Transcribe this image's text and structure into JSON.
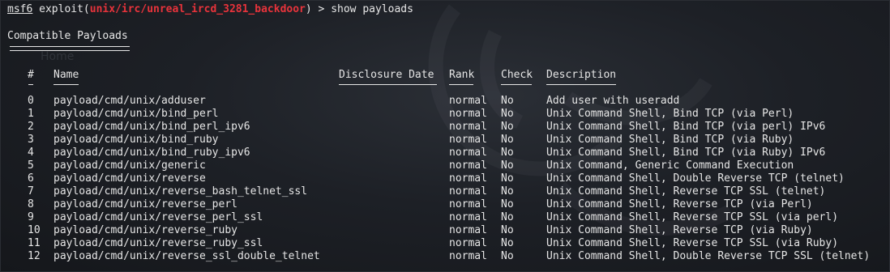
{
  "prompt": {
    "msf": "msf6",
    "exploit_prefix": " exploit(",
    "module": "unix/irc/unreal_ircd_3281_backdoor",
    "suffix": ") > ",
    "command": "show payloads"
  },
  "section_title": "Compatible Payloads",
  "background_ghost_text": "Home",
  "columns": {
    "num": "#",
    "name": "Name",
    "disclosure_date": "Disclosure Date",
    "rank": "Rank",
    "check": "Check",
    "description": "Description"
  },
  "rows": [
    {
      "num": "0",
      "name": "payload/cmd/unix/adduser",
      "rank": "normal",
      "check": "No",
      "description": "Add user with useradd"
    },
    {
      "num": "1",
      "name": "payload/cmd/unix/bind_perl",
      "rank": "normal",
      "check": "No",
      "description": "Unix Command Shell, Bind TCP (via Perl)"
    },
    {
      "num": "2",
      "name": "payload/cmd/unix/bind_perl_ipv6",
      "rank": "normal",
      "check": "No",
      "description": "Unix Command Shell, Bind TCP (via perl) IPv6"
    },
    {
      "num": "3",
      "name": "payload/cmd/unix/bind_ruby",
      "rank": "normal",
      "check": "No",
      "description": "Unix Command Shell, Bind TCP (via Ruby)"
    },
    {
      "num": "4",
      "name": "payload/cmd/unix/bind_ruby_ipv6",
      "rank": "normal",
      "check": "No",
      "description": "Unix Command Shell, Bind TCP (via Ruby) IPv6"
    },
    {
      "num": "5",
      "name": "payload/cmd/unix/generic",
      "rank": "normal",
      "check": "No",
      "description": "Unix Command, Generic Command Execution"
    },
    {
      "num": "6",
      "name": "payload/cmd/unix/reverse",
      "rank": "normal",
      "check": "No",
      "description": "Unix Command Shell, Double Reverse TCP (telnet)"
    },
    {
      "num": "7",
      "name": "payload/cmd/unix/reverse_bash_telnet_ssl",
      "rank": "normal",
      "check": "No",
      "description": "Unix Command Shell, Reverse TCP SSL (telnet)"
    },
    {
      "num": "8",
      "name": "payload/cmd/unix/reverse_perl",
      "rank": "normal",
      "check": "No",
      "description": "Unix Command Shell, Reverse TCP (via Perl)"
    },
    {
      "num": "9",
      "name": "payload/cmd/unix/reverse_perl_ssl",
      "rank": "normal",
      "check": "No",
      "description": "Unix Command Shell, Reverse TCP SSL (via perl)"
    },
    {
      "num": "10",
      "name": "payload/cmd/unix/reverse_ruby",
      "rank": "normal",
      "check": "No",
      "description": "Unix Command Shell, Reverse TCP (via Ruby)"
    },
    {
      "num": "11",
      "name": "payload/cmd/unix/reverse_ruby_ssl",
      "rank": "normal",
      "check": "No",
      "description": "Unix Command Shell, Reverse TCP SSL (via Ruby)"
    },
    {
      "num": "12",
      "name": "payload/cmd/unix/reverse_ssl_double_telnet",
      "rank": "normal",
      "check": "No",
      "description": "Unix Command Shell, Double Reverse TCP SSL (telnet)"
    }
  ],
  "colors": {
    "background": "#1d2026",
    "text": "#e6e6e6",
    "module_red": "#e8333b"
  }
}
